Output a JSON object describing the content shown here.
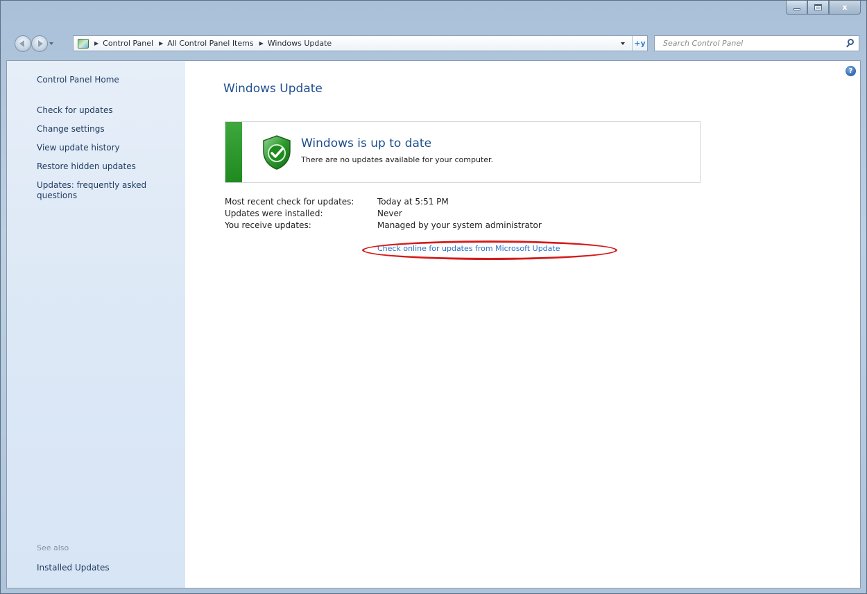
{
  "window": {
    "caption_icons": [
      "minimize-icon",
      "maximize-icon",
      "close-icon"
    ],
    "close_glyph": "x"
  },
  "address": {
    "crumbs": [
      "Control Panel",
      "All Control Panel Items",
      "Windows Update"
    ],
    "refresh_glyph": "+y"
  },
  "search": {
    "placeholder": "Search Control Panel"
  },
  "sidebar": {
    "home": "Control Panel Home",
    "items": [
      {
        "label": "Check for updates"
      },
      {
        "label": "Change settings"
      },
      {
        "label": "View update history"
      },
      {
        "label": "Restore hidden updates"
      },
      {
        "label": "Updates: frequently asked questions"
      }
    ],
    "see_also": "See also",
    "installed_updates": "Installed Updates"
  },
  "main": {
    "help_glyph": "?",
    "title": "Windows Update",
    "status": {
      "heading": "Windows is up to date",
      "subtext": "There are no updates available for your computer."
    },
    "info": [
      {
        "label": "Most recent check for updates:",
        "value": "Today at 5:51 PM"
      },
      {
        "label": "Updates were installed:",
        "value": "Never"
      },
      {
        "label": "You receive updates:",
        "value": "Managed by your system administrator"
      }
    ],
    "ms_update_link": "Check online for updates from Microsoft Update"
  },
  "colors": {
    "status_green": "#2a962a",
    "link_blue": "#2d6fc6",
    "title_blue": "#1e4f8f",
    "annotation_red": "#d41b1b"
  }
}
